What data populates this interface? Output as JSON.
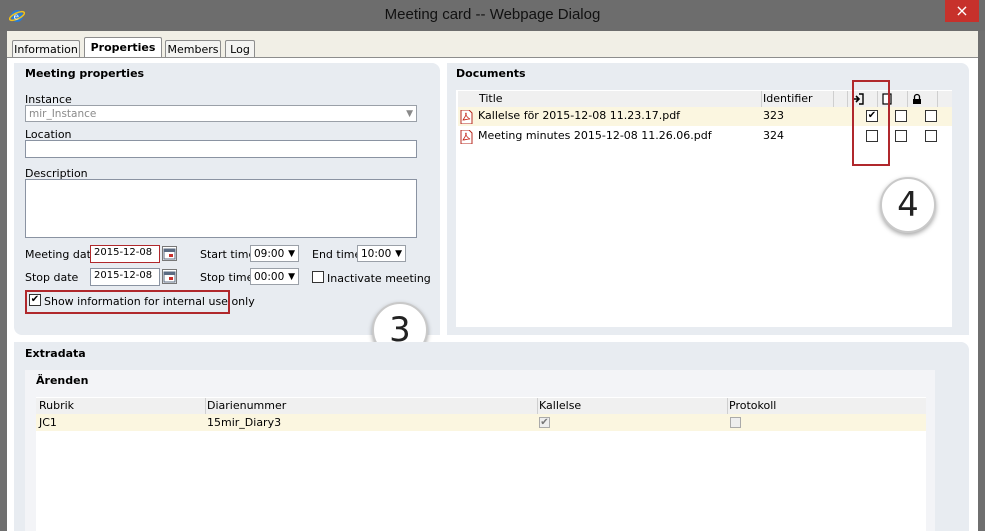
{
  "window": {
    "title": "Meeting card -- Webpage Dialog",
    "close_glyph": "×",
    "icon": "ie-icon"
  },
  "tabs": [
    "Information",
    "Properties",
    "Members",
    "Log"
  ],
  "active_tab": "Properties",
  "meeting": {
    "title": "Meeting properties",
    "instance_label": "Instance",
    "instance_value": "mir_Instance",
    "location_label": "Location",
    "location_value": "",
    "description_label": "Description",
    "description_value": "",
    "meeting_date_label": "Meeting date",
    "meeting_date_value": "2015-12-08",
    "start_time_label": "Start time",
    "start_time_value": "09:00",
    "end_time_label": "End time",
    "end_time_value": "10:00",
    "stop_date_label": "Stop date",
    "stop_date_value": "2015-12-08",
    "stop_time_label": "Stop time",
    "stop_time_value": "00:00",
    "inactivate_label": "Inactivate meeting",
    "inactivate_checked": false,
    "show_info_label": "Show information for internal use only",
    "show_info_checked": true,
    "badge": "3"
  },
  "documents": {
    "title": "Documents",
    "columns": {
      "title": "Title",
      "identifier": "Identifier"
    },
    "header_icons": [
      "sign-in-icon",
      "page-icon",
      "lock-icon"
    ],
    "rows": [
      {
        "name": "Kallelse för 2015-12-08 11.23.17.pdf",
        "identifier": "323",
        "checks": [
          true,
          false,
          false
        ]
      },
      {
        "name": "Meeting minutes 2015-12-08 11.26.06.pdf",
        "identifier": "324",
        "checks": [
          false,
          false,
          false
        ]
      }
    ],
    "badge": "4",
    "check_glyph": "✔"
  },
  "extradata": {
    "title": "Extradata",
    "subsection": "Ärenden",
    "columns": [
      "Rubrik",
      "Diarienummer",
      "Kallelse",
      "Protokoll"
    ],
    "rows": [
      {
        "rubrik": "JC1",
        "diarienummer": "15mir_Diary3",
        "kallelse": true,
        "protokoll": false
      }
    ]
  },
  "colors": {
    "accent_red": "#b0282c",
    "highlight_row": "#fbf6e0",
    "panel_bg": "#e8ecf1"
  }
}
